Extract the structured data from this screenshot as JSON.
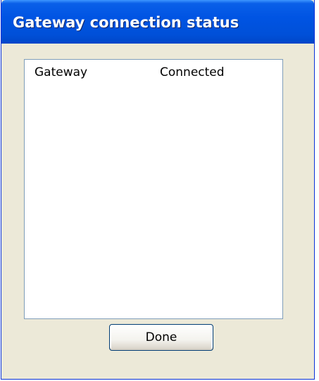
{
  "window": {
    "title": "Gateway connection status"
  },
  "status_list": {
    "rows": [
      {
        "name": "Gateway",
        "status": "Connected"
      }
    ]
  },
  "buttons": {
    "done_label": "Done"
  },
  "colors": {
    "titlebar": "#0054e3",
    "dialog_background": "#ece9d8",
    "list_border": "#7f9db9"
  }
}
